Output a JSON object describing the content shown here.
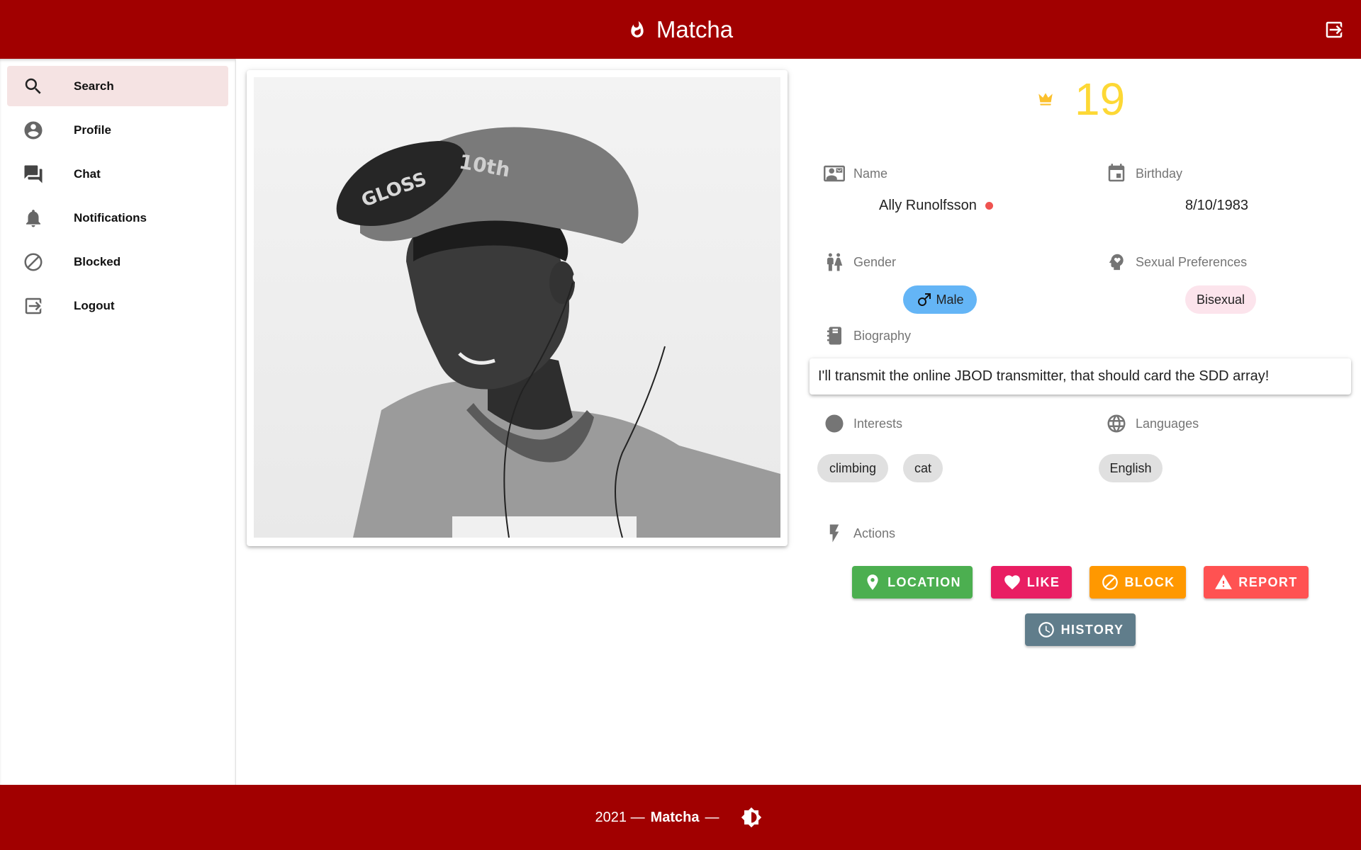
{
  "app": {
    "title": "Matcha"
  },
  "sidebar": {
    "items": [
      {
        "label": "Search",
        "icon": "search-icon"
      },
      {
        "label": "Profile",
        "icon": "account-circle-icon"
      },
      {
        "label": "Chat",
        "icon": "chat-icon"
      },
      {
        "label": "Notifications",
        "icon": "bell-icon"
      },
      {
        "label": "Blocked",
        "icon": "block-icon"
      },
      {
        "label": "Logout",
        "icon": "logout-icon"
      }
    ]
  },
  "profile": {
    "score": "19",
    "name_label": "Name",
    "name": "Ally Runolfsson",
    "birthday_label": "Birthday",
    "birthday": "8/10/1983",
    "gender_label": "Gender",
    "gender": "Male",
    "preferences_label": "Sexual Preferences",
    "preference": "Bisexual",
    "biography_label": "Biography",
    "biography": "I'll transmit the online JBOD transmitter, that should card the SDD array!",
    "interests_label": "Interests",
    "interests": [
      "climbing",
      "cat"
    ],
    "languages_label": "Languages",
    "languages": [
      "English"
    ],
    "actions_label": "Actions"
  },
  "actions": {
    "location": "LOCATION",
    "like": "LIKE",
    "block": "BLOCK",
    "report": "REPORT",
    "history": "HISTORY"
  },
  "footer": {
    "year": "2021 —",
    "brand": "Matcha",
    "dash": "—"
  },
  "colors": {
    "brand": "#a10000",
    "location": "#4caf50",
    "like": "#e91e63",
    "block": "#ff9800",
    "report": "#ff5252",
    "history": "#607d8b",
    "score": "#fdd835"
  }
}
